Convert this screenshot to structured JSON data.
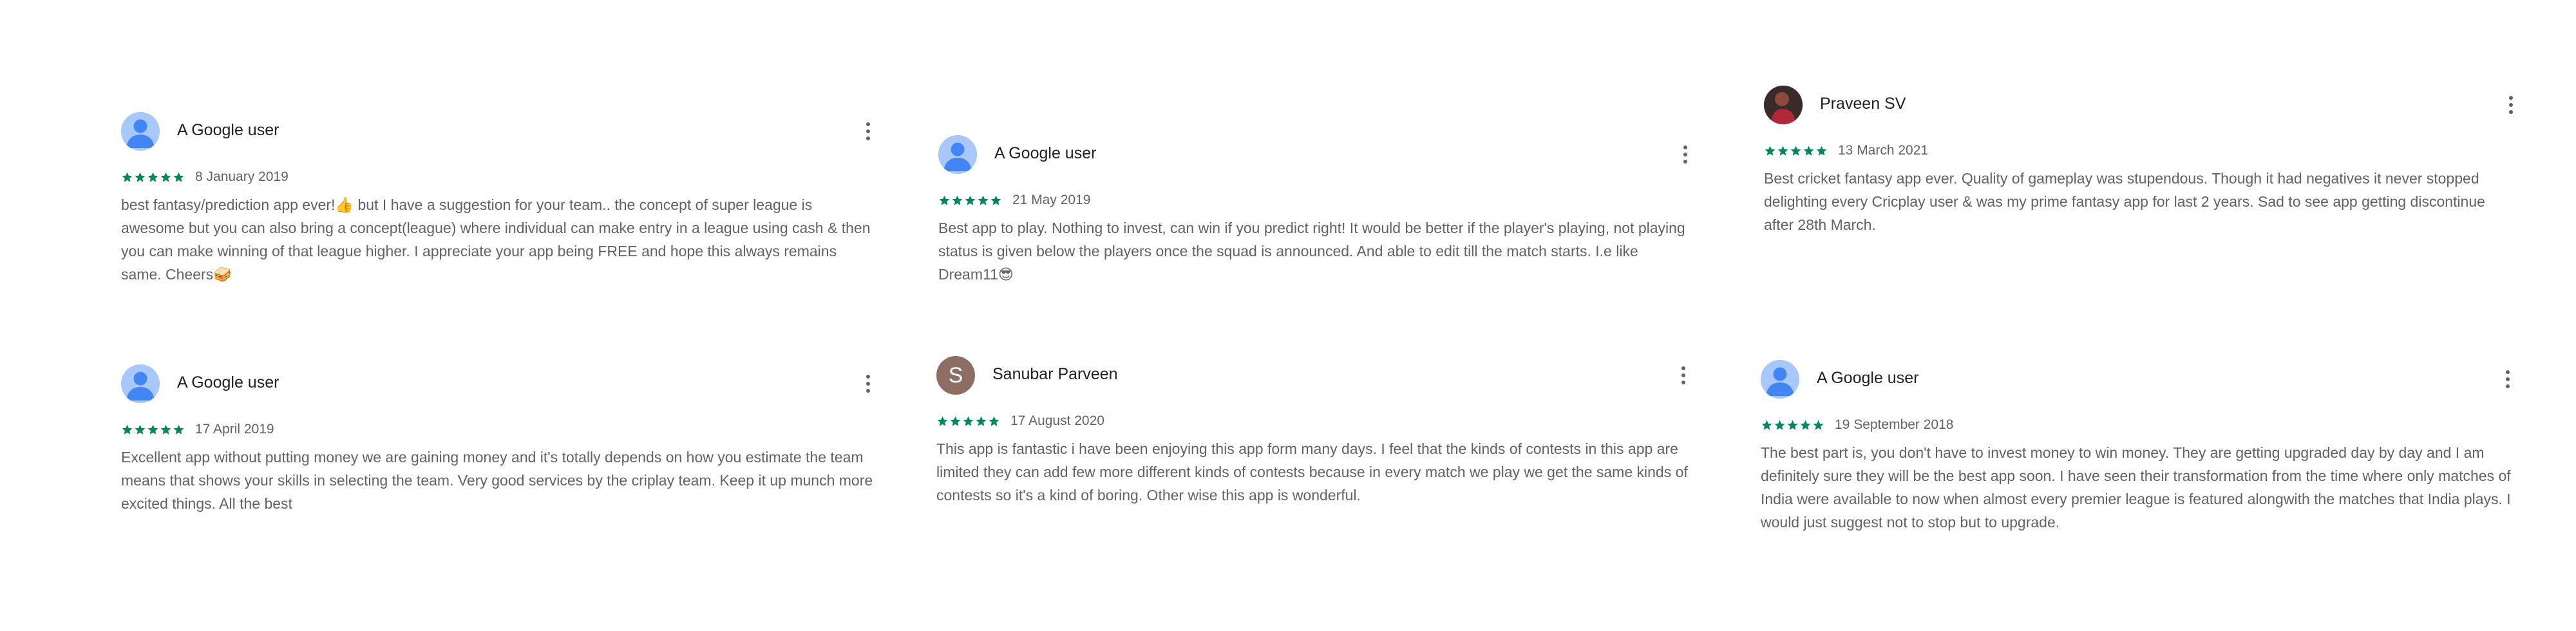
{
  "colors": {
    "star": "#01875f",
    "avatar_default": "#a8c7fa",
    "avatar_person": "#4285f4",
    "avatar_letter_bg": "#8d6e63"
  },
  "reviews": [
    {
      "name": "A Google user",
      "avatar": "default-user-icon",
      "rating": 5,
      "date": "8 January 2019",
      "text": "best fantasy/prediction app ever!👍 but I have a suggestion for your team.. the concept of super league is awesome but you can also bring a concept(league) where individual can make entry in a league using cash & then you can make winning of that league higher. I appreciate your app being FREE and hope this always remains same. Cheers🥪"
    },
    {
      "name": "A Google user",
      "avatar": "default-user-icon",
      "rating": 5,
      "date": "21 May 2019",
      "text": "Best app to play. Nothing to invest, can win if you predict right! It would be better if the player's playing, not playing status is given below the players once the squad is announced. And able to edit till the match starts. I.e like Dream11😎"
    },
    {
      "name": "Praveen SV",
      "avatar": "profile-photo",
      "rating": 5,
      "date": "13 March 2021",
      "text": "Best cricket fantasy app ever. Quality of gameplay was stupendous. Though it had negatives it never stopped delighting every Cricplay user & was my prime fantasy app for last 2 years. Sad to see app getting discontinue after 28th March."
    },
    {
      "name": "A Google user",
      "avatar": "default-user-icon",
      "rating": 5,
      "date": "17 April 2019",
      "text": "Excellent app without putting money we are gaining money and it's totally depends on how you estimate the team means that shows your skills in selecting the team. Very good services by the criplay team. Keep it up munch more excited things. All the best"
    },
    {
      "name": "Sanubar Parveen",
      "avatar": "letter-avatar",
      "avatar_letter": "S",
      "rating": 5,
      "date": "17 August 2020",
      "text": "This app is fantastic i have been enjoying this app form many days. I feel that the kinds of contests in this app are limited they can add few more different kinds of contests because in every match we play we get the same kinds of contests so it's a kind of boring. Other wise this app is wonderful."
    },
    {
      "name": "A Google user",
      "avatar": "default-user-icon",
      "rating": 5,
      "date": "19 September 2018",
      "text": "The best part is, you don't have to invest money to win money. They are getting upgraded day by day and I am definitely sure they will be the best app soon. I have seen their transformation from the time where only matches of India were available to now when almost every premier league is featured alongwith the matches that India plays. I would just suggest not to stop but to upgrade."
    }
  ]
}
